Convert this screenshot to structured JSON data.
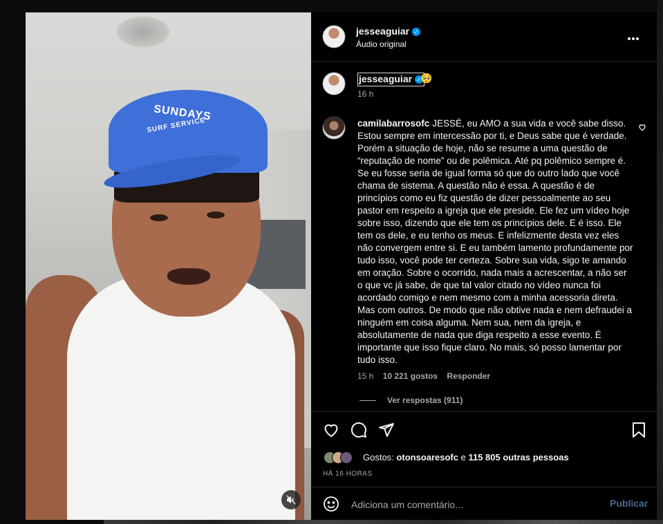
{
  "header": {
    "username": "jesseaguiar",
    "subtitle": "Áudio original",
    "more_icon": "more-horizontal-icon"
  },
  "video": {
    "cap_line1": "SUNDAYS",
    "cap_line2": "SURF SERVICE",
    "mute_icon": "speaker-muted-icon"
  },
  "caption": {
    "username": "jesseaguiar",
    "emoji": "🥺",
    "time": "16 h"
  },
  "comment": {
    "username": "camilabarrosofc",
    "text": "JESSÉ, eu AMO a sua vida e você sabe disso. Estou sempre em intercessão por ti, e Deus sabe que é verdade. Porém a situação de hoje, não se resume a uma questão de “reputação de nome” ou de polêmica. Até pq polêmico sempre é. Se eu fosse seria de igual forma só que do outro lado que você chama de sistema. A questão não é essa. A questão é de princípios como eu fiz questão de dizer pessoalmente ao seu pastor em respeito a igreja que ele preside. Ele fez um vídeo hoje sobre isso, dizendo que ele tem os princípios dele. E é isso. Ele tem os dele, e eu tenho os meus. E infelizmente desta vez eles não convergem entre si. E eu também lamento profundamente por tudo isso, você pode ter certeza. Sobre sua vida, sigo te amando em oração. Sobre o ocorrido, nada mais a acrescentar, a não ser o que vc já sabe, de que tal valor citado no vídeo nunca foi acordado comigo e nem mesmo com a minha acessoria direta. Mas com outros. De modo que não obtive nada e nem defraudei a ninguém em coisa alguma. Nem sua, nem da igreja, e absolutamente de nada que diga respeito a esse evento. É importante que isso fique claro. No mais, só posso lamentar por tudo isso.",
    "time": "15 h",
    "likes": "10 221 gostos",
    "reply": "Responder",
    "view_replies": "Ver respostas (911)"
  },
  "actions": {
    "likes_prefix": "Gostos:",
    "liker": "otonsoaresofc",
    "likes_mid": " e ",
    "likes_others": "115 805 outras pessoas",
    "posted": "HÁ 16 HORAS"
  },
  "composer": {
    "placeholder": "Adiciona um comentário...",
    "publish": "Publicar"
  },
  "colors": {
    "verified": "#0095f6",
    "cap": "#3f6fd8",
    "publish_disabled": "#4a6a8c"
  }
}
